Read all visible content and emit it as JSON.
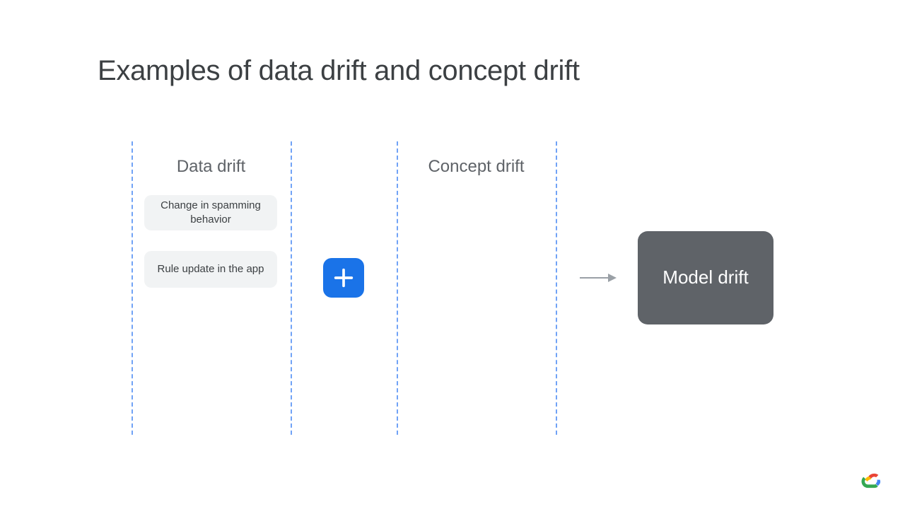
{
  "title": "Examples of data drift and concept drift",
  "columns": {
    "data_drift": {
      "heading": "Data drift"
    },
    "concept_drift": {
      "heading": "Concept drift"
    }
  },
  "data_drift_items": [
    "Change in spamming behavior",
    "Rule update in the app"
  ],
  "plus_symbol": "+",
  "result_box": "Model drift"
}
